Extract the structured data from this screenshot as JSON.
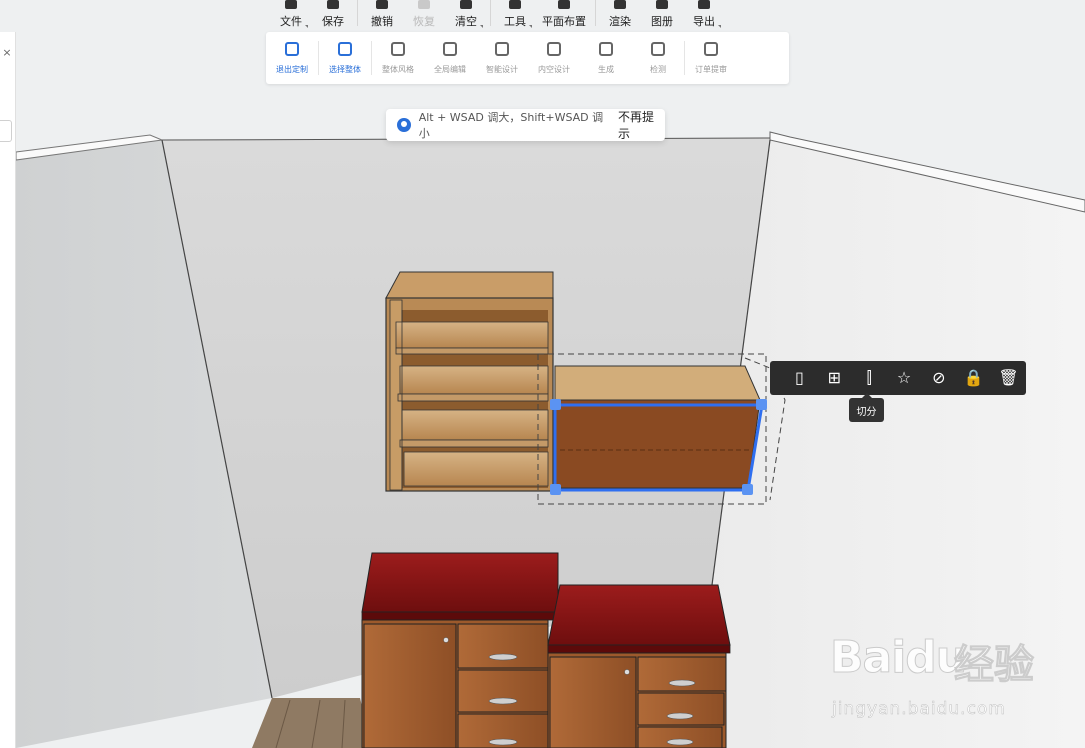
{
  "toolbar": {
    "items": [
      {
        "label": "文件",
        "icon": "home-icon",
        "dropdown": true
      },
      {
        "label": "保存",
        "icon": "save-icon",
        "dropdown": false
      },
      {
        "label": "撤销",
        "icon": "undo-icon",
        "dropdown": false
      },
      {
        "label": "恢复",
        "icon": "redo-icon",
        "dropdown": false,
        "disabled": true
      },
      {
        "label": "清空",
        "icon": "eraser-icon",
        "dropdown": true
      },
      {
        "label": "工具",
        "icon": "wrench-icon",
        "dropdown": true
      },
      {
        "label": "平面布置",
        "icon": "floorplan-icon",
        "dropdown": false
      },
      {
        "label": "渲染",
        "icon": "render-icon",
        "dropdown": false
      },
      {
        "label": "图册",
        "icon": "album-icon",
        "dropdown": false
      },
      {
        "label": "导出",
        "icon": "export-icon",
        "dropdown": true
      }
    ]
  },
  "subtoolbar": {
    "items": [
      {
        "label": "退出定制",
        "icon": "exit-icon",
        "active": true
      },
      {
        "label": "选择整体",
        "icon": "select-all-icon",
        "active": true
      },
      {
        "label": "整体风格",
        "icon": "paint-roller-icon",
        "active": false
      },
      {
        "label": "全局编辑",
        "icon": "global-edit-icon",
        "active": false
      },
      {
        "label": "智能设计",
        "icon": "smart-design-icon",
        "active": false
      },
      {
        "label": "内空设计",
        "icon": "inner-space-icon",
        "active": false
      },
      {
        "label": "生成",
        "icon": "generate-icon",
        "active": false
      },
      {
        "label": "检测",
        "icon": "detect-icon",
        "active": false
      },
      {
        "label": "订单提审",
        "icon": "order-submit-icon",
        "active": false
      }
    ]
  },
  "hint": {
    "text": "Alt + WSAD 调大，Shift+WSAD 调小",
    "dismiss": "不再提示",
    "icon": "info-icon"
  },
  "left_panel": {
    "close_symbol": "×"
  },
  "floating_toolbar": {
    "buttons": [
      {
        "name": "door-icon",
        "glyph": "▯"
      },
      {
        "name": "copy-add-icon",
        "glyph": "⊞"
      },
      {
        "name": "split-icon",
        "glyph": "⫿"
      },
      {
        "name": "star-icon",
        "glyph": "☆"
      },
      {
        "name": "hide-icon",
        "glyph": "⊘"
      },
      {
        "name": "lock-icon",
        "glyph": "🔒"
      },
      {
        "name": "delete-icon",
        "glyph": "🗑"
      }
    ],
    "tooltip": "切分"
  },
  "watermark": {
    "brand": "Baidu",
    "brand_cn": "经验",
    "url": "jingyan.baidu.com"
  },
  "colors": {
    "accent": "#2a6fd8",
    "selection": "#3b7ff0",
    "wood_light": "#c49a68",
    "wood_mid": "#a0683a",
    "wood_dark": "#7a4320",
    "lacquer_red": "#8a1212",
    "wall": "#d0d0d0",
    "floor": "#8a7560"
  }
}
